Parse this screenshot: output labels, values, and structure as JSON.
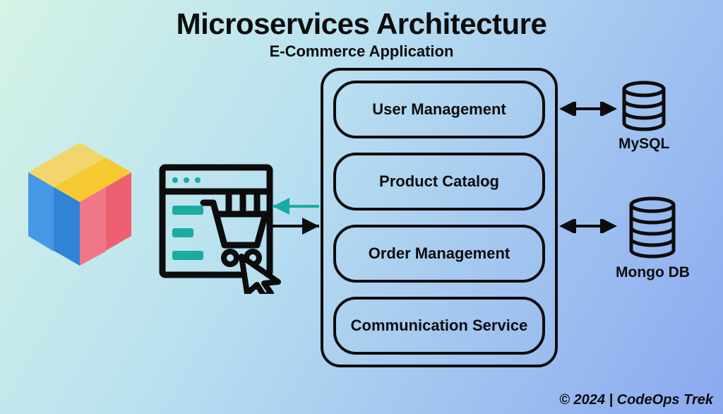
{
  "title": "Microservices Architecture",
  "subtitle": "E-Commerce Application",
  "services": [
    "User Management",
    "Product Catalog",
    "Order Management",
    "Communication Service"
  ],
  "databases": {
    "mysql": {
      "label": "MySQL"
    },
    "mongo": {
      "label": "Mongo DB"
    }
  },
  "footer": "© 2024 | CodeOps Trek",
  "icons": {
    "cube": "cube-icon",
    "webshop": "shopping-cart-browser-icon",
    "database": "database-stack-icon"
  },
  "colors": {
    "stroke": "#0c0c0c",
    "teal": "#1aaba2",
    "cube_yellow": "#f7c930",
    "cube_blue": "#2f84d6",
    "cube_pink": "#ed6072"
  }
}
